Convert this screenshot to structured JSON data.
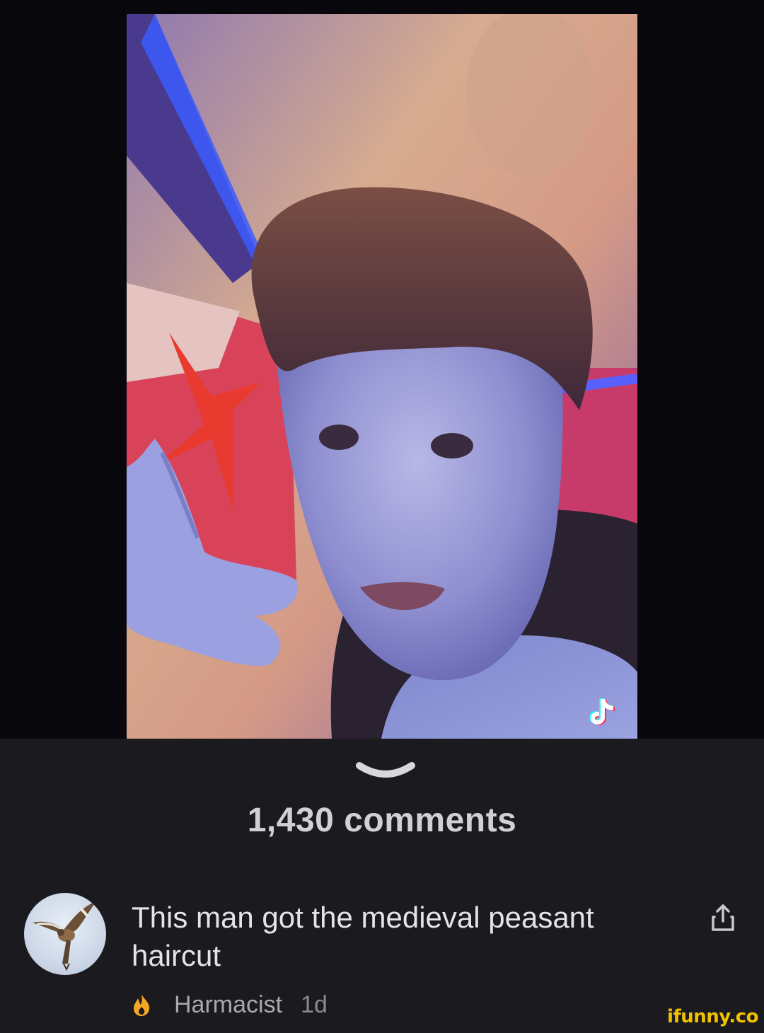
{
  "video": {
    "platform_logo_icon": "tiktok-note-icon"
  },
  "panel": {
    "collapse_icon": "chevron-down-icon",
    "comments_count": "1,430 comments"
  },
  "comment": {
    "avatar_icon": "bird-avatar",
    "text": "This man got the medieval peasant haircut",
    "share_icon": "share-icon",
    "badge_icon": "flame-icon",
    "username": "Harmacist",
    "age": "1d"
  },
  "watermark": {
    "text": "ifunny.co"
  },
  "colors": {
    "panel_background": "#1a1a1f",
    "letterbox": "#07070c",
    "comment_text": "#e4e4e8",
    "meta_text": "#a8a8ae",
    "flame": "#f5a623",
    "watermark": "#f2c200"
  }
}
